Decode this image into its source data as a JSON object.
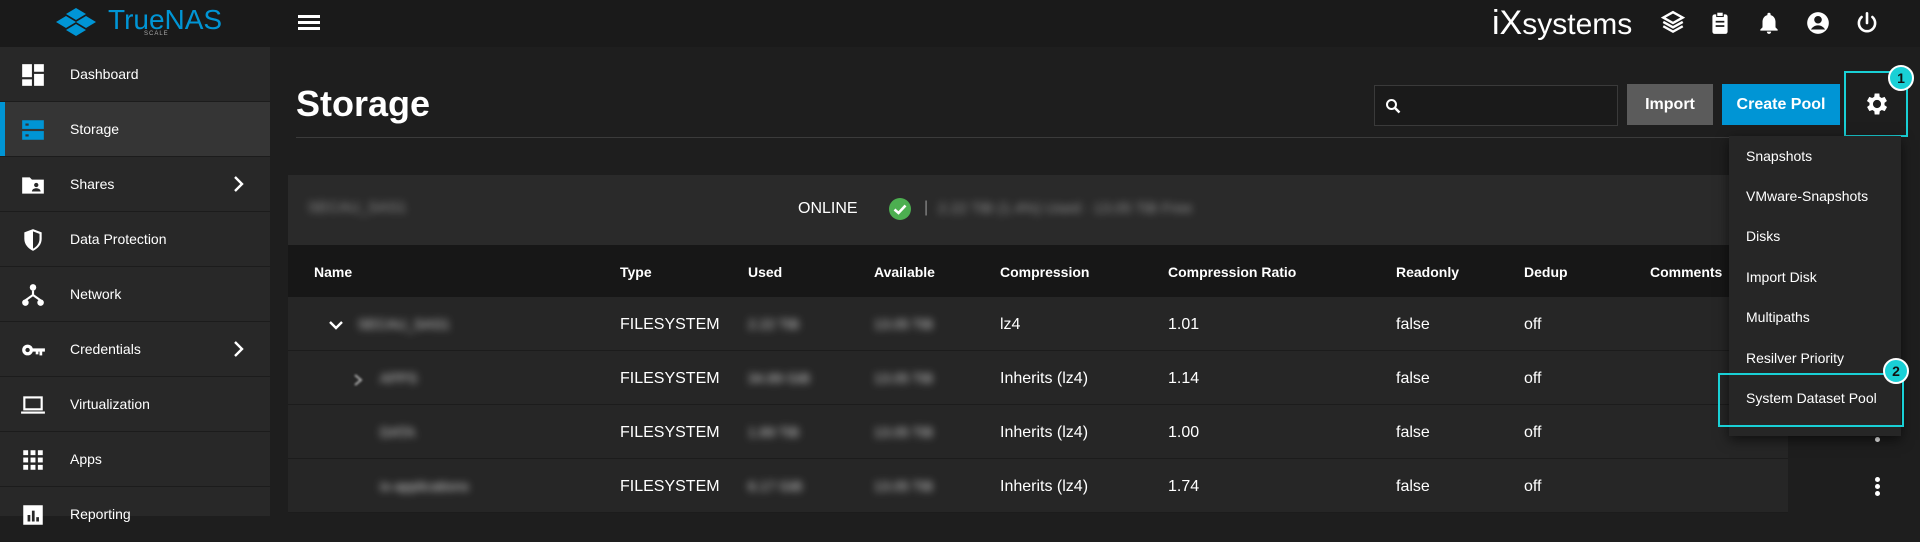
{
  "app": {
    "logo_text": "TrueNAS",
    "logo_sub": "SCALE",
    "vendor_prefix": "iX",
    "vendor": "systems"
  },
  "topbar_icons": [
    "truecommand-icon",
    "clipboard-icon",
    "bell-icon",
    "account-icon",
    "power-icon"
  ],
  "sidebar": {
    "items": [
      {
        "label": "Dashboard",
        "icon": "dashboard-icon",
        "chevron": false,
        "active": false
      },
      {
        "label": "Storage",
        "icon": "storage-icon",
        "chevron": false,
        "active": true
      },
      {
        "label": "Shares",
        "icon": "folder-share-icon",
        "chevron": true,
        "active": false
      },
      {
        "label": "Data Protection",
        "icon": "shield-icon",
        "chevron": false,
        "active": false
      },
      {
        "label": "Network",
        "icon": "network-icon",
        "chevron": false,
        "active": false
      },
      {
        "label": "Credentials",
        "icon": "key-icon",
        "chevron": true,
        "active": false
      },
      {
        "label": "Virtualization",
        "icon": "laptop-icon",
        "chevron": false,
        "active": false
      },
      {
        "label": "Apps",
        "icon": "apps-grid-icon",
        "chevron": false,
        "active": false
      },
      {
        "label": "Reporting",
        "icon": "chart-icon",
        "chevron": false,
        "active": false
      }
    ]
  },
  "page": {
    "title": "Storage",
    "import_label": "Import",
    "create_pool_label": "Create Pool",
    "search_value": ""
  },
  "markers": {
    "first": "1",
    "second": "2"
  },
  "pool": {
    "name": "SECAU_SAS1",
    "status": "ONLINE",
    "separator": "|",
    "usage": "2.22 TiB (1.4%) Used  ·  13.05 TiB Free"
  },
  "table": {
    "headers": {
      "name": "Name",
      "type": "Type",
      "used": "Used",
      "available": "Available",
      "compression": "Compression",
      "ratio": "Compression Ratio",
      "readonly": "Readonly",
      "dedup": "Dedup",
      "comments": "Comments"
    },
    "rows": [
      {
        "name": "SECAU_SAS1",
        "type": "FILESYSTEM",
        "used": "2.22 TiB",
        "available": "13.05 TiB",
        "compression": "lz4",
        "ratio": "1.01",
        "readonly": "false",
        "dedup": "off"
      },
      {
        "name": "APPS",
        "type": "FILESYSTEM",
        "used": "34.89 GiB",
        "available": "13.05 TiB",
        "compression": "Inherits (lz4)",
        "ratio": "1.14",
        "readonly": "false",
        "dedup": "off"
      },
      {
        "name": "DATA",
        "type": "FILESYSTEM",
        "used": "1.89 TiB",
        "available": "13.05 TiB",
        "compression": "Inherits (lz4)",
        "ratio": "1.00",
        "readonly": "false",
        "dedup": "off"
      },
      {
        "name": "ix-applications",
        "type": "FILESYSTEM",
        "used": "6.17 GiB",
        "available": "13.05 TiB",
        "compression": "Inherits (lz4)",
        "ratio": "1.74",
        "readonly": "false",
        "dedup": "off"
      }
    ]
  },
  "settings_menu": {
    "items": [
      "Snapshots",
      "VMware-Snapshots",
      "Disks",
      "Import Disk",
      "Multipaths",
      "Resilver Priority",
      "System Dataset Pool"
    ]
  },
  "colors": {
    "accent": "#0095d5",
    "highlight": "#19d0d6",
    "online": "#4caf50"
  }
}
